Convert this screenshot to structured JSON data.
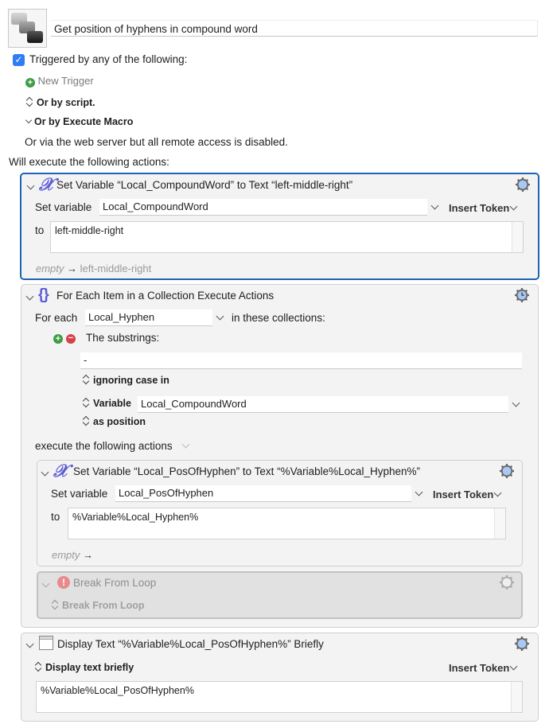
{
  "macro": {
    "icon": "keyboard-keys-icon",
    "title": "Get position of hyphens in compound word"
  },
  "triggers": {
    "checkbox_checked": true,
    "triggered_label": "Triggered by any of the following:",
    "new_trigger": "New Trigger",
    "or_by_script": "Or by script.",
    "or_by_execute_macro": "Or by Execute Macro",
    "web_server_note": "Or via the web server but all remote access is disabled."
  },
  "will_execute": "Will execute the following actions:",
  "actions": [
    {
      "type": "set-variable",
      "title": "Set Variable “Local_CompoundWord” to Text “left-middle-right”",
      "set_variable_label": "Set variable",
      "variable": "Local_CompoundWord",
      "insert_token": "Insert Token",
      "to_label": "to",
      "value": "left-middle-right",
      "preview_empty": "empty",
      "preview_arrow": "→",
      "preview_value": "left-middle-right",
      "selected": true
    },
    {
      "type": "for-each",
      "title": "For Each Item in a Collection Execute Actions",
      "for_each_label": "For each",
      "variable": "Local_Hyphen",
      "in_collections": "in these collections:",
      "collection_label": "The substrings:",
      "substring": "-",
      "ignoring_case": "ignoring case in",
      "source_type": "Variable",
      "source_variable": "Local_CompoundWord",
      "as_position": "as position",
      "execute_label": "execute the following actions",
      "children": [
        {
          "type": "set-variable",
          "title": "Set Variable “Local_PosOfHyphen” to Text “%Variable%Local_Hyphen%”",
          "set_variable_label": "Set variable",
          "variable": "Local_PosOfHyphen",
          "insert_token": "Insert Token",
          "to_label": "to",
          "value": "%Variable%Local_Hyphen%",
          "preview_empty": "empty",
          "preview_arrow": "→"
        },
        {
          "type": "break-from-loop",
          "title": "Break From Loop",
          "option": "Break From Loop",
          "disabled": true
        }
      ]
    },
    {
      "type": "display-text",
      "title": "Display Text “%Variable%Local_PosOfHyphen%” Briefly",
      "mode": "Display text briefly",
      "insert_token": "Insert Token",
      "value": "%Variable%Local_PosOfHyphen%"
    }
  ],
  "colors": {
    "accent": "#1d64b5",
    "checkbox": "#2e7cf6",
    "add": "#3e9d44",
    "remove": "#d8414a",
    "variable_icon": "#5b5bd6"
  }
}
